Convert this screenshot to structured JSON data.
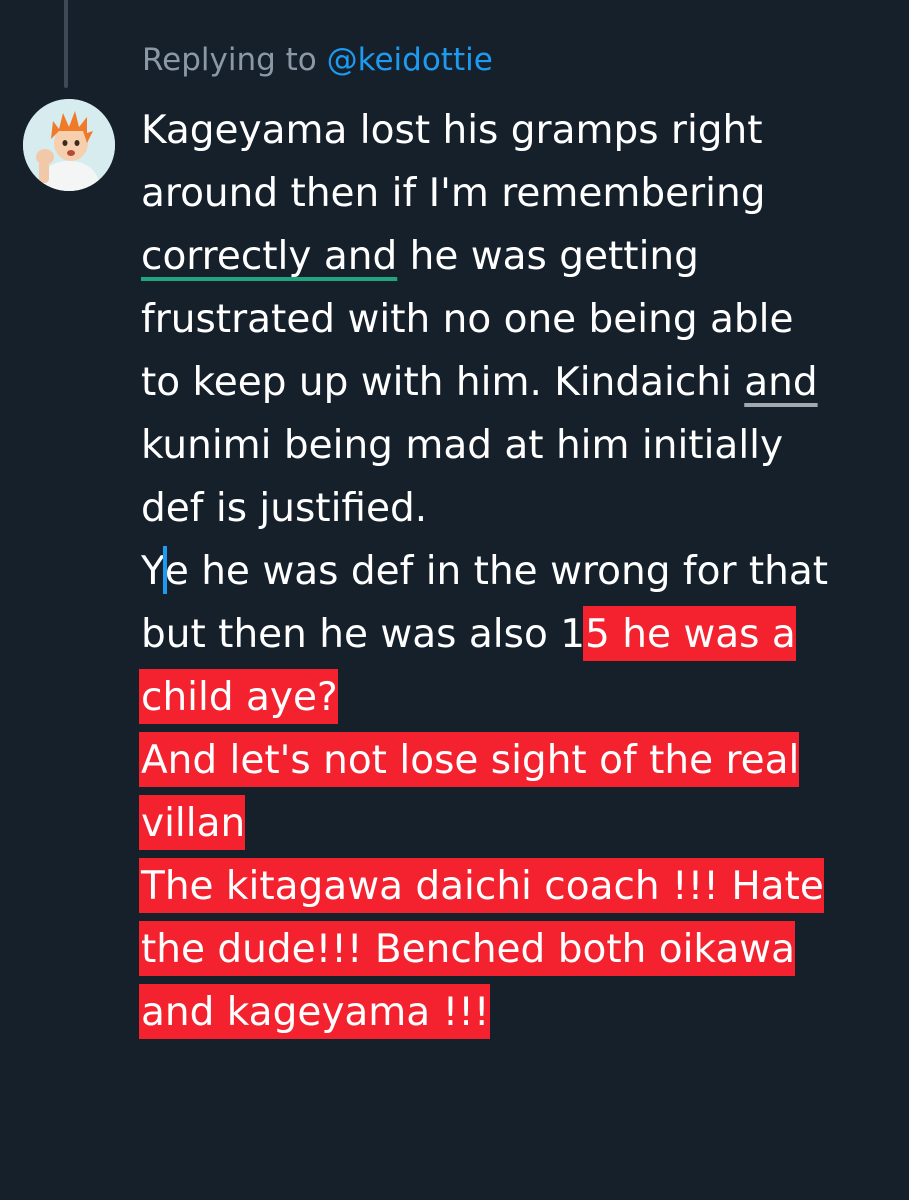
{
  "reply": {
    "prefix": "Replying to ",
    "handle": "@keidottie"
  },
  "tweet": {
    "line1": "Kageyama lost his gramps right",
    "line2": "around then if I'm remembering",
    "line3_ul": "correctly and",
    "line3_rest": " he was getting",
    "line4": "frustrated with no one being able",
    "line5_a": "to keep up with him. Kindaichi ",
    "line5_ul": "and",
    "line6": "kunimi being mad at him initially",
    "line7": "def is justified.",
    "line8_a": "Y",
    "line8_b": "e he was def in the wrong for that",
    "line9_a": "but then he was also 1",
    "line9_hl": "5 he was a ",
    "line10_hl": "child aye?",
    "line11_hl": "And let's not lose sight of the real",
    "line12_hl": "villan ",
    "line13_hl": "The kitagawa daichi coach !!! Hate",
    "line14_hl": "the dude!!! Benched both oikawa",
    "line15_hl": "and kageyama !!!"
  },
  "colors": {
    "background": "#15202b",
    "highlight": "#f4212e",
    "link": "#1d9bf0",
    "secondary_text": "#8b98a5"
  },
  "icons": {
    "avatar": "avatar-icon"
  }
}
